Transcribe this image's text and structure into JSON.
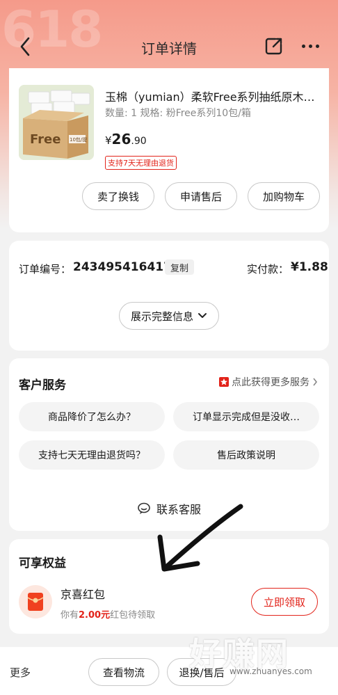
{
  "header": {
    "banner_text": "618",
    "title": "订单详情",
    "icons": {
      "back": "chevron-left-icon",
      "share": "share-icon",
      "more": "more-dots-icon"
    }
  },
  "product": {
    "name": "玉棉（yumian）柔软Free系列抽纸原木…",
    "spec": "数量: 1   规格: 粉Free系列10包/箱",
    "price_symbol": "¥",
    "price_int": "26",
    "price_dec": ".90",
    "tag": "支持7天无理由退货",
    "thumb_text": "Free",
    "thumb_badge": "10包/提",
    "actions": [
      "卖了换钱",
      "申请售后",
      "加购物车"
    ]
  },
  "order": {
    "number_label": "订单编号：",
    "number": "243495416417",
    "copy_label": "复制",
    "paid_label": "实付款：",
    "paid_value": "¥1.88",
    "expand_label": "展示完整信息"
  },
  "service": {
    "title": "客户服务",
    "more_label": "点此获得更多服务",
    "questions": [
      "商品降价了怎么办？",
      "订单显示完成但是没收…",
      "支持七天无理由退货吗？",
      "售后政策说明"
    ],
    "contact_label": "联系客服"
  },
  "benefits": {
    "title": "可享权益",
    "name": "京喜红包",
    "desc_prefix": "你有",
    "desc_amount": "2.00元",
    "desc_suffix": "红包待领取",
    "claim_label": "立即领取"
  },
  "bottom": {
    "more_label": "更多",
    "logistics_label": "查看物流",
    "return_label": "退换/售后"
  },
  "watermark": {
    "main": "好赚网",
    "sub": "www.zhuanyes.com"
  },
  "colors": {
    "accent": "#e2231a",
    "header_gradient_top": "#f59a8a"
  }
}
